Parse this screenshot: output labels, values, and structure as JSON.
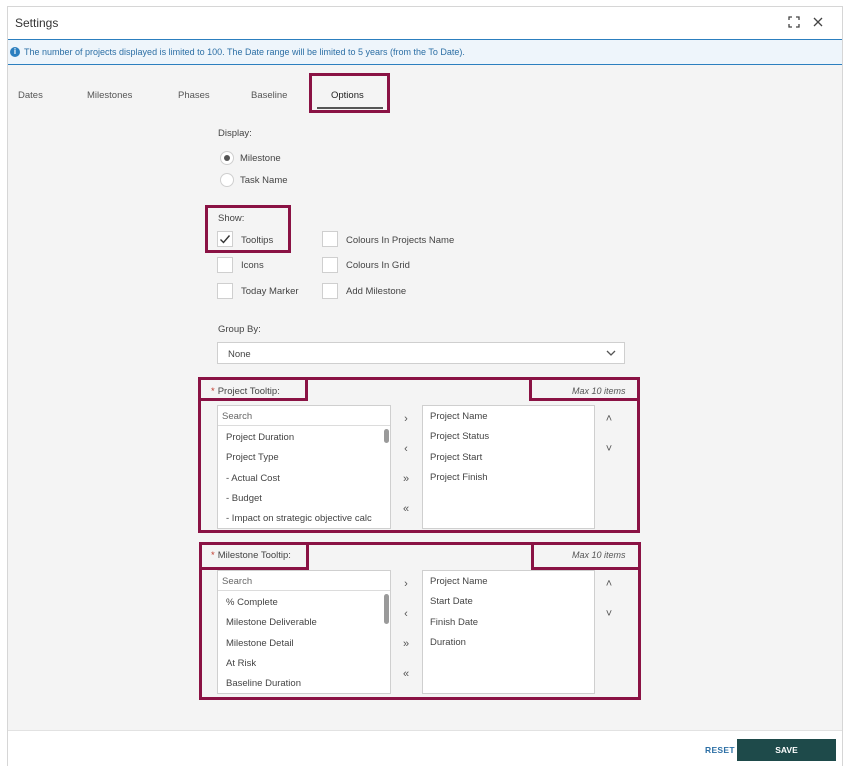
{
  "window": {
    "title": "Settings"
  },
  "info": {
    "message": "The number of projects displayed is limited to 100. The Date range will be limited to 5 years (from the To Date)."
  },
  "tabs": [
    {
      "label": "Dates"
    },
    {
      "label": "Milestones"
    },
    {
      "label": "Phases"
    },
    {
      "label": "Baseline"
    },
    {
      "label": "Options",
      "active": true
    }
  ],
  "display": {
    "label": "Display:",
    "options": [
      {
        "label": "Milestone",
        "selected": true
      },
      {
        "label": "Task Name",
        "selected": false
      }
    ]
  },
  "show": {
    "label": "Show:",
    "checkboxes": [
      {
        "label": "Tooltips",
        "checked": true
      },
      {
        "label": "Icons",
        "checked": false
      },
      {
        "label": "Today Marker",
        "checked": false
      },
      {
        "label": "Colours In Projects Name",
        "checked": false
      },
      {
        "label": "Colours In Grid",
        "checked": false
      },
      {
        "label": "Add Milestone",
        "checked": false
      }
    ]
  },
  "group_by": {
    "label": "Group By:",
    "value": "None"
  },
  "project_tooltip": {
    "required_mark": "*",
    "label": "Project Tooltip:",
    "max": "Max 10 items",
    "search_placeholder": "Search",
    "available": [
      "Project Duration",
      "Project Type",
      "- Actual Cost",
      "- Budget",
      "- Impact on strategic objective calc"
    ],
    "selected": [
      "Project Name",
      "Project Status",
      "Project Start",
      "Project Finish"
    ]
  },
  "milestone_tooltip": {
    "required_mark": "*",
    "label": "Milestone Tooltip:",
    "max": "Max 10 items",
    "search_placeholder": "Search",
    "available": [
      "% Complete",
      "Milestone Deliverable",
      "Milestone Detail",
      "At Risk",
      "Baseline Duration"
    ],
    "selected": [
      "Project Name",
      "Start Date",
      "Finish Date",
      "Duration"
    ]
  },
  "transfer_arrows": {
    "move_right": "›",
    "move_left": "‹",
    "move_all_right": "»",
    "move_all_left": "«",
    "up": "˄",
    "down": "˅"
  },
  "footer": {
    "reset_label": "RESET",
    "save_label": "SAVE"
  },
  "colors": {
    "accent": "#2c7fbf",
    "highlight": "#8a1244",
    "save_bg": "#1e4a4a"
  }
}
